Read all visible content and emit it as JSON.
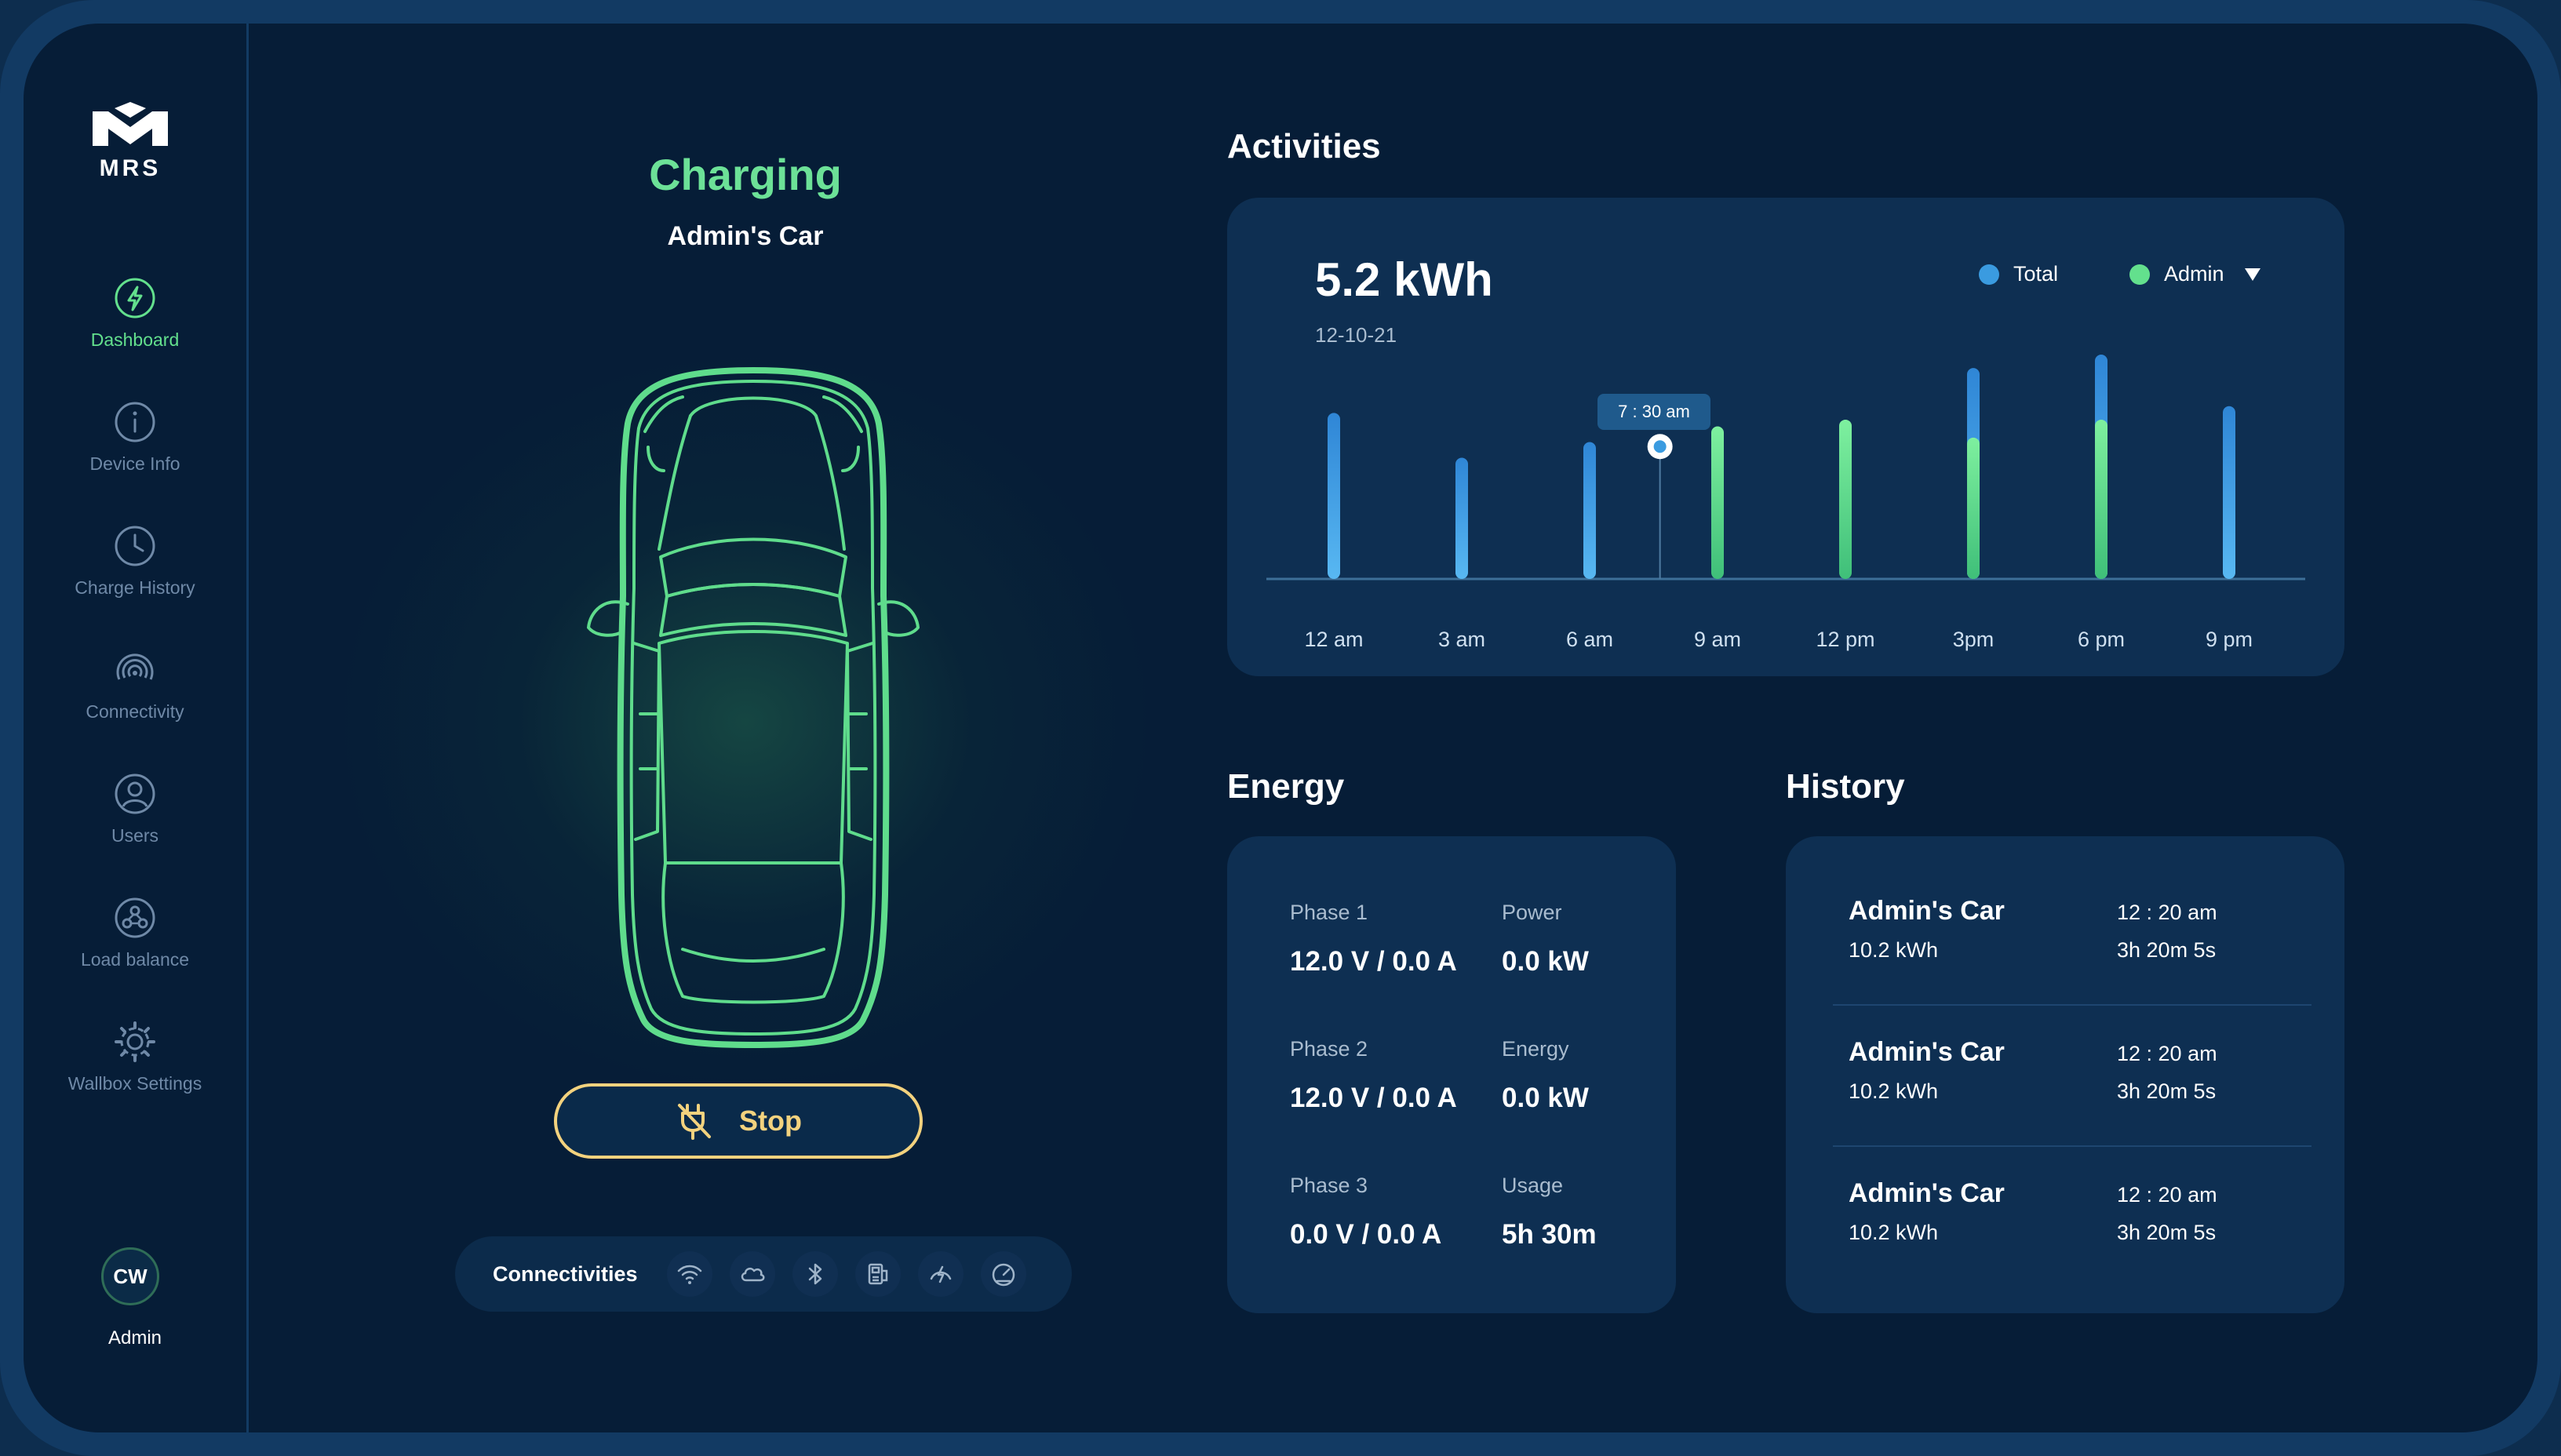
{
  "brand": {
    "logo_text": "MRS"
  },
  "sidebar": {
    "items": [
      {
        "label": "Dashboard"
      },
      {
        "label": "Device Info"
      },
      {
        "label": "Charge History"
      },
      {
        "label": "Connectivity"
      },
      {
        "label": "Users"
      },
      {
        "label": "Load balance"
      },
      {
        "label": "Wallbox Settings"
      }
    ],
    "user": {
      "initials": "CW",
      "label": "Admin"
    }
  },
  "status": {
    "title": "Charging",
    "subtitle": "Admin's Car"
  },
  "stop_button": {
    "label": "Stop"
  },
  "connectivities": {
    "label": "Connectivities",
    "icons": [
      "wifi-icon",
      "cloud-icon",
      "bluetooth-icon",
      "ethernet-icon",
      "charge-speed-icon",
      "gauge-icon"
    ]
  },
  "colors": {
    "accent_green": "#63e08d",
    "accent_blue": "#3a9be0",
    "stop_yellow": "#f3d27e"
  },
  "activities": {
    "heading": "Activities",
    "total": "5.2 kWh",
    "date": "12-10-21",
    "legend": {
      "total": "Total",
      "admin": "Admin"
    },
    "tooltip": "7 : 30 am"
  },
  "chart_data": {
    "type": "bar",
    "title": "",
    "x_ticks": [
      "12 am",
      "3 am",
      "6 am",
      "9 am",
      "12 pm",
      "3pm",
      "6 pm",
      "9  pm"
    ],
    "series": [
      {
        "name": "Total",
        "values": [
          0.74,
          0.54,
          0.61,
          0,
          0,
          0.94,
          1.0,
          0.77
        ]
      },
      {
        "name": "Admin",
        "values": [
          0,
          0,
          0,
          0.68,
          0.71,
          0.63,
          0.71,
          0
        ]
      }
    ],
    "ylim": [
      0,
      1
    ],
    "marker": {
      "x_index": 2.55,
      "value": 0.59
    },
    "grid": false,
    "legend_position": "top-right"
  },
  "energy": {
    "heading": "Energy",
    "rows": [
      {
        "l1": "Phase 1",
        "v1": "12.0 V / 0.0 A",
        "l2": "Power",
        "v2": "0.0 kW"
      },
      {
        "l1": "Phase 2",
        "v1": "12.0 V / 0.0 A",
        "l2": "Energy",
        "v2": "0.0 kW"
      },
      {
        "l1": "Phase 3",
        "v1": "0.0 V / 0.0 A",
        "l2": "Usage",
        "v2": "5h 30m"
      }
    ]
  },
  "history": {
    "heading": "History",
    "items": [
      {
        "name": "Admin's Car",
        "kwh": "10.2 kWh",
        "time": "12 : 20 am",
        "duration": "3h 20m 5s"
      },
      {
        "name": "Admin's Car",
        "kwh": "10.2 kWh",
        "time": "12 : 20 am",
        "duration": "3h 20m 5s"
      },
      {
        "name": "Admin's Car",
        "kwh": "10.2 kWh",
        "time": "12 : 20 am",
        "duration": "3h 20m 5s"
      }
    ]
  }
}
